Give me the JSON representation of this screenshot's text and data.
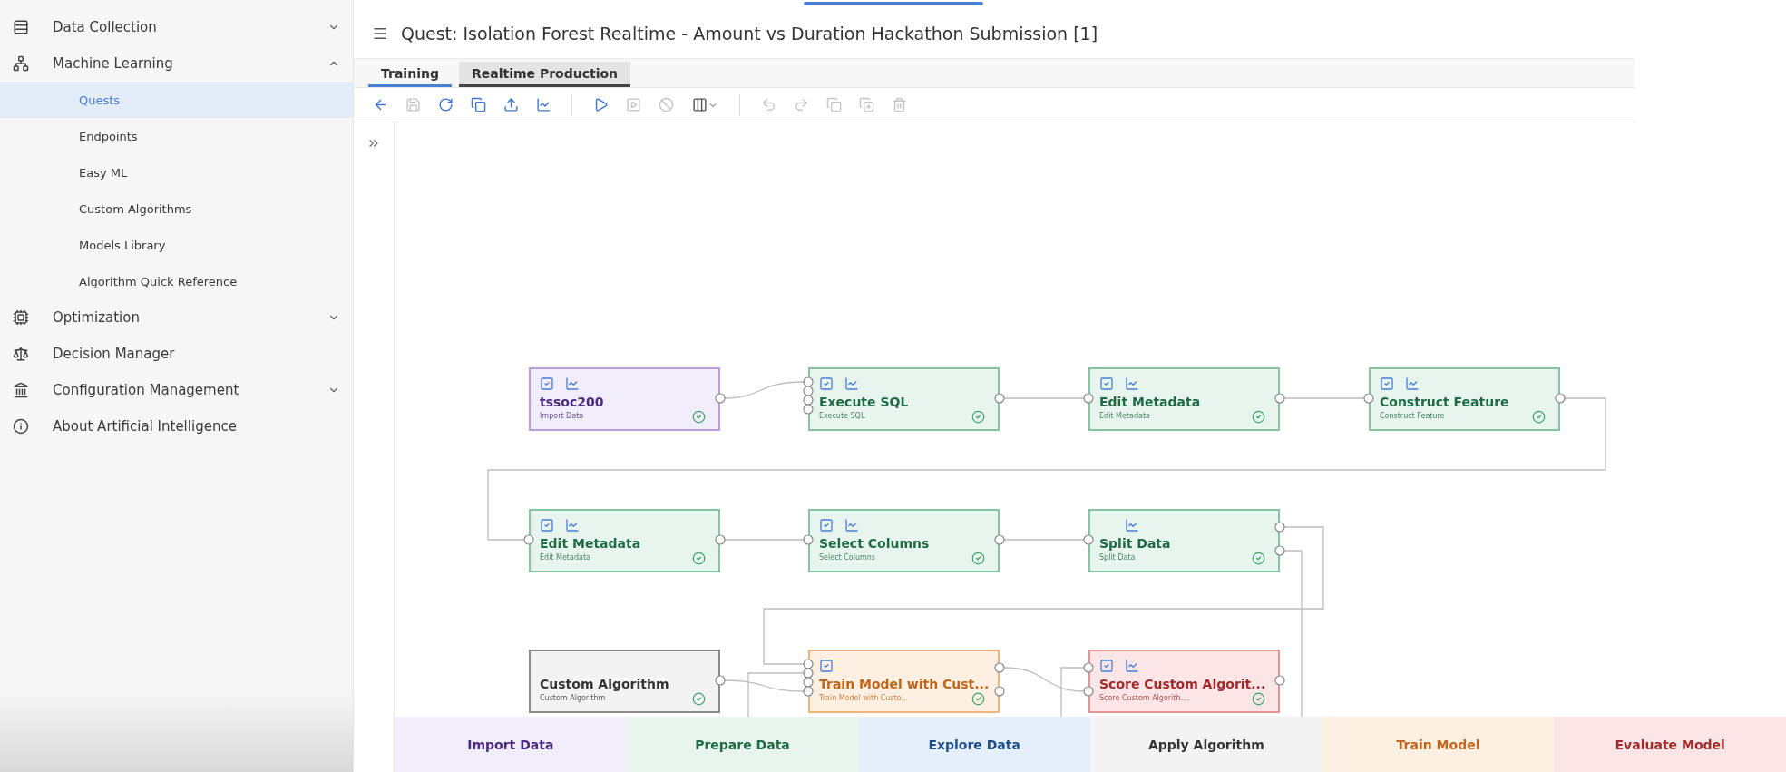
{
  "sidebar": {
    "items": [
      {
        "label": "Data Collection",
        "kind": "group",
        "expanded": false,
        "selected": false
      },
      {
        "label": "Machine Learning",
        "kind": "group",
        "expanded": true,
        "selected": false,
        "children": [
          {
            "label": "Quests",
            "selected": true
          },
          {
            "label": "Endpoints",
            "selected": false
          },
          {
            "label": "Easy ML",
            "selected": false
          },
          {
            "label": "Custom Algorithms",
            "selected": false
          },
          {
            "label": "Models Library",
            "selected": false
          },
          {
            "label": "Algorithm Quick Reference",
            "selected": false
          }
        ]
      },
      {
        "label": "Optimization",
        "kind": "group",
        "expanded": false,
        "selected": false
      },
      {
        "label": "Decision Manager",
        "kind": "link",
        "selected": false
      },
      {
        "label": "Configuration Management",
        "kind": "group",
        "expanded": false,
        "selected": false
      },
      {
        "label": "About Artificial Intelligence",
        "kind": "link",
        "selected": false
      }
    ]
  },
  "header": {
    "title": "Quest: Isolation Forest Realtime - Amount vs Duration Hackathon Submission [1]"
  },
  "tabs": [
    {
      "label": "Training",
      "selected": true,
      "hovered": false
    },
    {
      "label": "Realtime Production",
      "selected": false,
      "hovered": true
    }
  ],
  "toolbar": [
    {
      "kind": "back",
      "disabled": false
    },
    {
      "kind": "save",
      "disabled": true
    },
    {
      "kind": "refresh",
      "disabled": false
    },
    {
      "kind": "duplicate",
      "disabled": false
    },
    {
      "kind": "export",
      "disabled": false
    },
    {
      "kind": "chart",
      "disabled": false
    },
    {
      "kind": "divider"
    },
    {
      "kind": "run",
      "disabled": false
    },
    {
      "kind": "runbox",
      "disabled": true
    },
    {
      "kind": "stop",
      "disabled": true
    },
    {
      "kind": "columns",
      "disabled": false
    },
    {
      "kind": "divider"
    },
    {
      "kind": "undo",
      "disabled": true
    },
    {
      "kind": "redo",
      "disabled": true
    },
    {
      "kind": "copy",
      "disabled": true
    },
    {
      "kind": "paste",
      "disabled": true
    },
    {
      "kind": "delete",
      "disabled": true
    }
  ],
  "nodes": [
    {
      "title": "tssoc200",
      "subtitle": "Import Data",
      "kind": "import",
      "editable": true,
      "visualizable": true,
      "complete": true
    },
    {
      "title": "Execute SQL",
      "subtitle": "Execute SQL",
      "kind": "prepare",
      "editable": true,
      "visualizable": true,
      "complete": true
    },
    {
      "title": "Edit Metadata",
      "subtitle": "Edit Metadata",
      "kind": "prepare",
      "editable": true,
      "visualizable": true,
      "complete": true
    },
    {
      "title": "Construct Feature",
      "subtitle": "Construct Feature",
      "kind": "prepare",
      "editable": true,
      "visualizable": true,
      "complete": true
    },
    {
      "title": "Edit Metadata",
      "subtitle": "Edit Metadata",
      "kind": "prepare",
      "editable": true,
      "visualizable": true,
      "complete": true
    },
    {
      "title": "Select Columns",
      "subtitle": "Select Columns",
      "kind": "prepare",
      "editable": true,
      "visualizable": true,
      "complete": true
    },
    {
      "title": "Split Data",
      "subtitle": "Split Data",
      "kind": "prepare",
      "editable": false,
      "visualizable": true,
      "complete": true
    },
    {
      "title": "Custom Algorithm",
      "subtitle": "Custom Algorithm",
      "kind": "apply",
      "editable": false,
      "visualizable": false,
      "complete": true
    },
    {
      "title": "Train Model with Cust...",
      "subtitle": "Train Model with Custo...",
      "kind": "train",
      "editable": true,
      "visualizable": false,
      "complete": true
    },
    {
      "title": "Score Custom Algorit...",
      "subtitle": "Score Custom Algorith....",
      "kind": "evaluate",
      "editable": true,
      "visualizable": true,
      "complete": true
    }
  ],
  "legend": [
    {
      "label": "Import Data",
      "kind": "import"
    },
    {
      "label": "Prepare Data",
      "kind": "prepare"
    },
    {
      "label": "Explore Data",
      "kind": "explore"
    },
    {
      "label": "Apply Algorithm",
      "kind": "apply"
    },
    {
      "label": "Train Model",
      "kind": "train"
    },
    {
      "label": "Evaluate Model",
      "kind": "evaluate"
    }
  ]
}
